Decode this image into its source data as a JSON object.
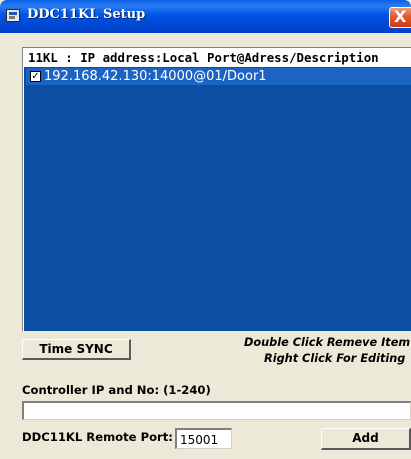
{
  "window": {
    "title": "DDC11KL Setup",
    "close_glyph": "X"
  },
  "list": {
    "header": "11KL : IP address:Local Port@Adress/Description",
    "items": [
      {
        "checked": true,
        "check_glyph": "✓",
        "text": "192.168.42.130:14000@01/Door1"
      }
    ]
  },
  "buttons": {
    "time_sync": "Time SYNC",
    "add": "Add"
  },
  "hints": {
    "remove": "Double Click Remeve Item",
    "edit": "Right Click For Editing"
  },
  "controller": {
    "label": "Controller IP  and No: (1-240)",
    "value": ""
  },
  "remote_port": {
    "label": "DDC11KL Remote Port:",
    "value": "15001"
  },
  "colors": {
    "title_bar": "#0055e5",
    "list_background": "#0b4ea2",
    "selected_item": "#1c63c6",
    "close_button": "#e4582c",
    "window_face": "#ece9d8"
  },
  "icons": [
    "app-icon",
    "close-icon",
    "checkbox-icon"
  ]
}
